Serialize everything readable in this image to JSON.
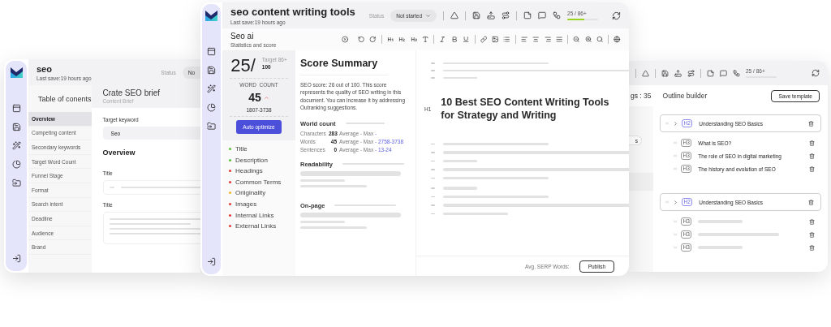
{
  "left_window": {
    "title": "seo",
    "last_saved": "Last save:19 hours ago",
    "status_label": "Status",
    "status_value": "No",
    "toc_title": "Table of conents",
    "toc_items": [
      {
        "label": "Overview",
        "selected": true
      },
      {
        "label": "Competing content",
        "selected": false
      },
      {
        "label": "Secondary keywords",
        "selected": false
      },
      {
        "label": "Target Word Count",
        "selected": false
      },
      {
        "label": "Funnel Stage",
        "selected": false
      },
      {
        "label": "Format",
        "selected": false
      },
      {
        "label": "Search intent",
        "selected": false
      },
      {
        "label": "Deadline",
        "selected": false
      },
      {
        "label": "Audience",
        "selected": false
      },
      {
        "label": "Brand",
        "selected": false
      }
    ],
    "brief_title": "Crate SEO brief",
    "brief_subtitle": "Content Brief",
    "keyword_label": "Target keyword",
    "keyword_value": "Seo",
    "section_title": "Overview",
    "fields": [
      {
        "label": "Title",
        "kind": "line"
      },
      {
        "label": "Title",
        "kind": "area"
      }
    ]
  },
  "main_window": {
    "title": "seo content writing tools",
    "last_saved": "Last save:19 hours ago",
    "status_label": "Status",
    "status_value": "Not started",
    "score_meter": {
      "text": "25 / 86+",
      "level": 0.55
    },
    "panel_title": "Seo ai",
    "panel_subtitle": "Statistics and score",
    "score_card": {
      "score": "25/",
      "target": "Target 86+",
      "max": "100",
      "word_count_label": "WORD  COUNT",
      "word_count": "45",
      "word_range": "1807-3738",
      "button": "Auto optimize"
    },
    "checks": [
      {
        "label": "Title",
        "color": "#5bbf3a"
      },
      {
        "label": "Description",
        "color": "#5bbf3a"
      },
      {
        "label": "Headings",
        "color": "#e53935"
      },
      {
        "label": "Common Terms",
        "color": "#e53935"
      },
      {
        "label": "Oriiginality",
        "color": "#f2b82c"
      },
      {
        "label": "Images",
        "color": "#e53935"
      },
      {
        "label": "Internal Links",
        "color": "#e53935"
      },
      {
        "label": "External Links",
        "color": "#e53935"
      }
    ],
    "summary": {
      "title": "Score Summary",
      "text": "SEO score: 26 out of 100. This score represents the quality of SEO writing in this document. You can increase it by addressing Outranking suggestions.",
      "world_count_title": "World count",
      "stats": [
        {
          "label": "Characters",
          "value": "283",
          "range": "Average - Max",
          "target": "-"
        },
        {
          "label": "Words",
          "value": "45",
          "range": "Average - Max",
          "target": "- 2758-3738"
        },
        {
          "label": "Sentences",
          "value": "0",
          "range": "Average - Max",
          "target": "- 13-24"
        }
      ],
      "readability_title": "Readability",
      "onpage_title": "On-page"
    },
    "editor": {
      "heading_tag": "H1",
      "heading": "10 Best SEO Content Writing Tools for Strategy and Writing",
      "serp_label": "Avg. SERP Words:",
      "publish": "Publish"
    }
  },
  "right_window": {
    "score_text": "25 / 86+",
    "cut_label": "gs : 35",
    "pill_fragment": "s",
    "outline_title": "Outline builder",
    "save_button": "Save template",
    "outline": [
      {
        "tag": "H2",
        "text": "Understanding SEO Basics",
        "children": [
          {
            "kind": "text",
            "tag": "H3",
            "text": "What is SEO?"
          },
          {
            "kind": "text",
            "tag": "H3",
            "text": "The role of SEO in digital marketing"
          },
          {
            "kind": "text",
            "tag": "H3",
            "text": "The history and evolution of SEO"
          }
        ]
      },
      {
        "tag": "H2",
        "text": "Understanding SEO Basics",
        "children": [
          {
            "kind": "placeholder",
            "tag": "H3"
          },
          {
            "kind": "placeholder",
            "tag": "H3"
          },
          {
            "kind": "placeholder",
            "tag": "H3"
          }
        ]
      }
    ]
  }
}
